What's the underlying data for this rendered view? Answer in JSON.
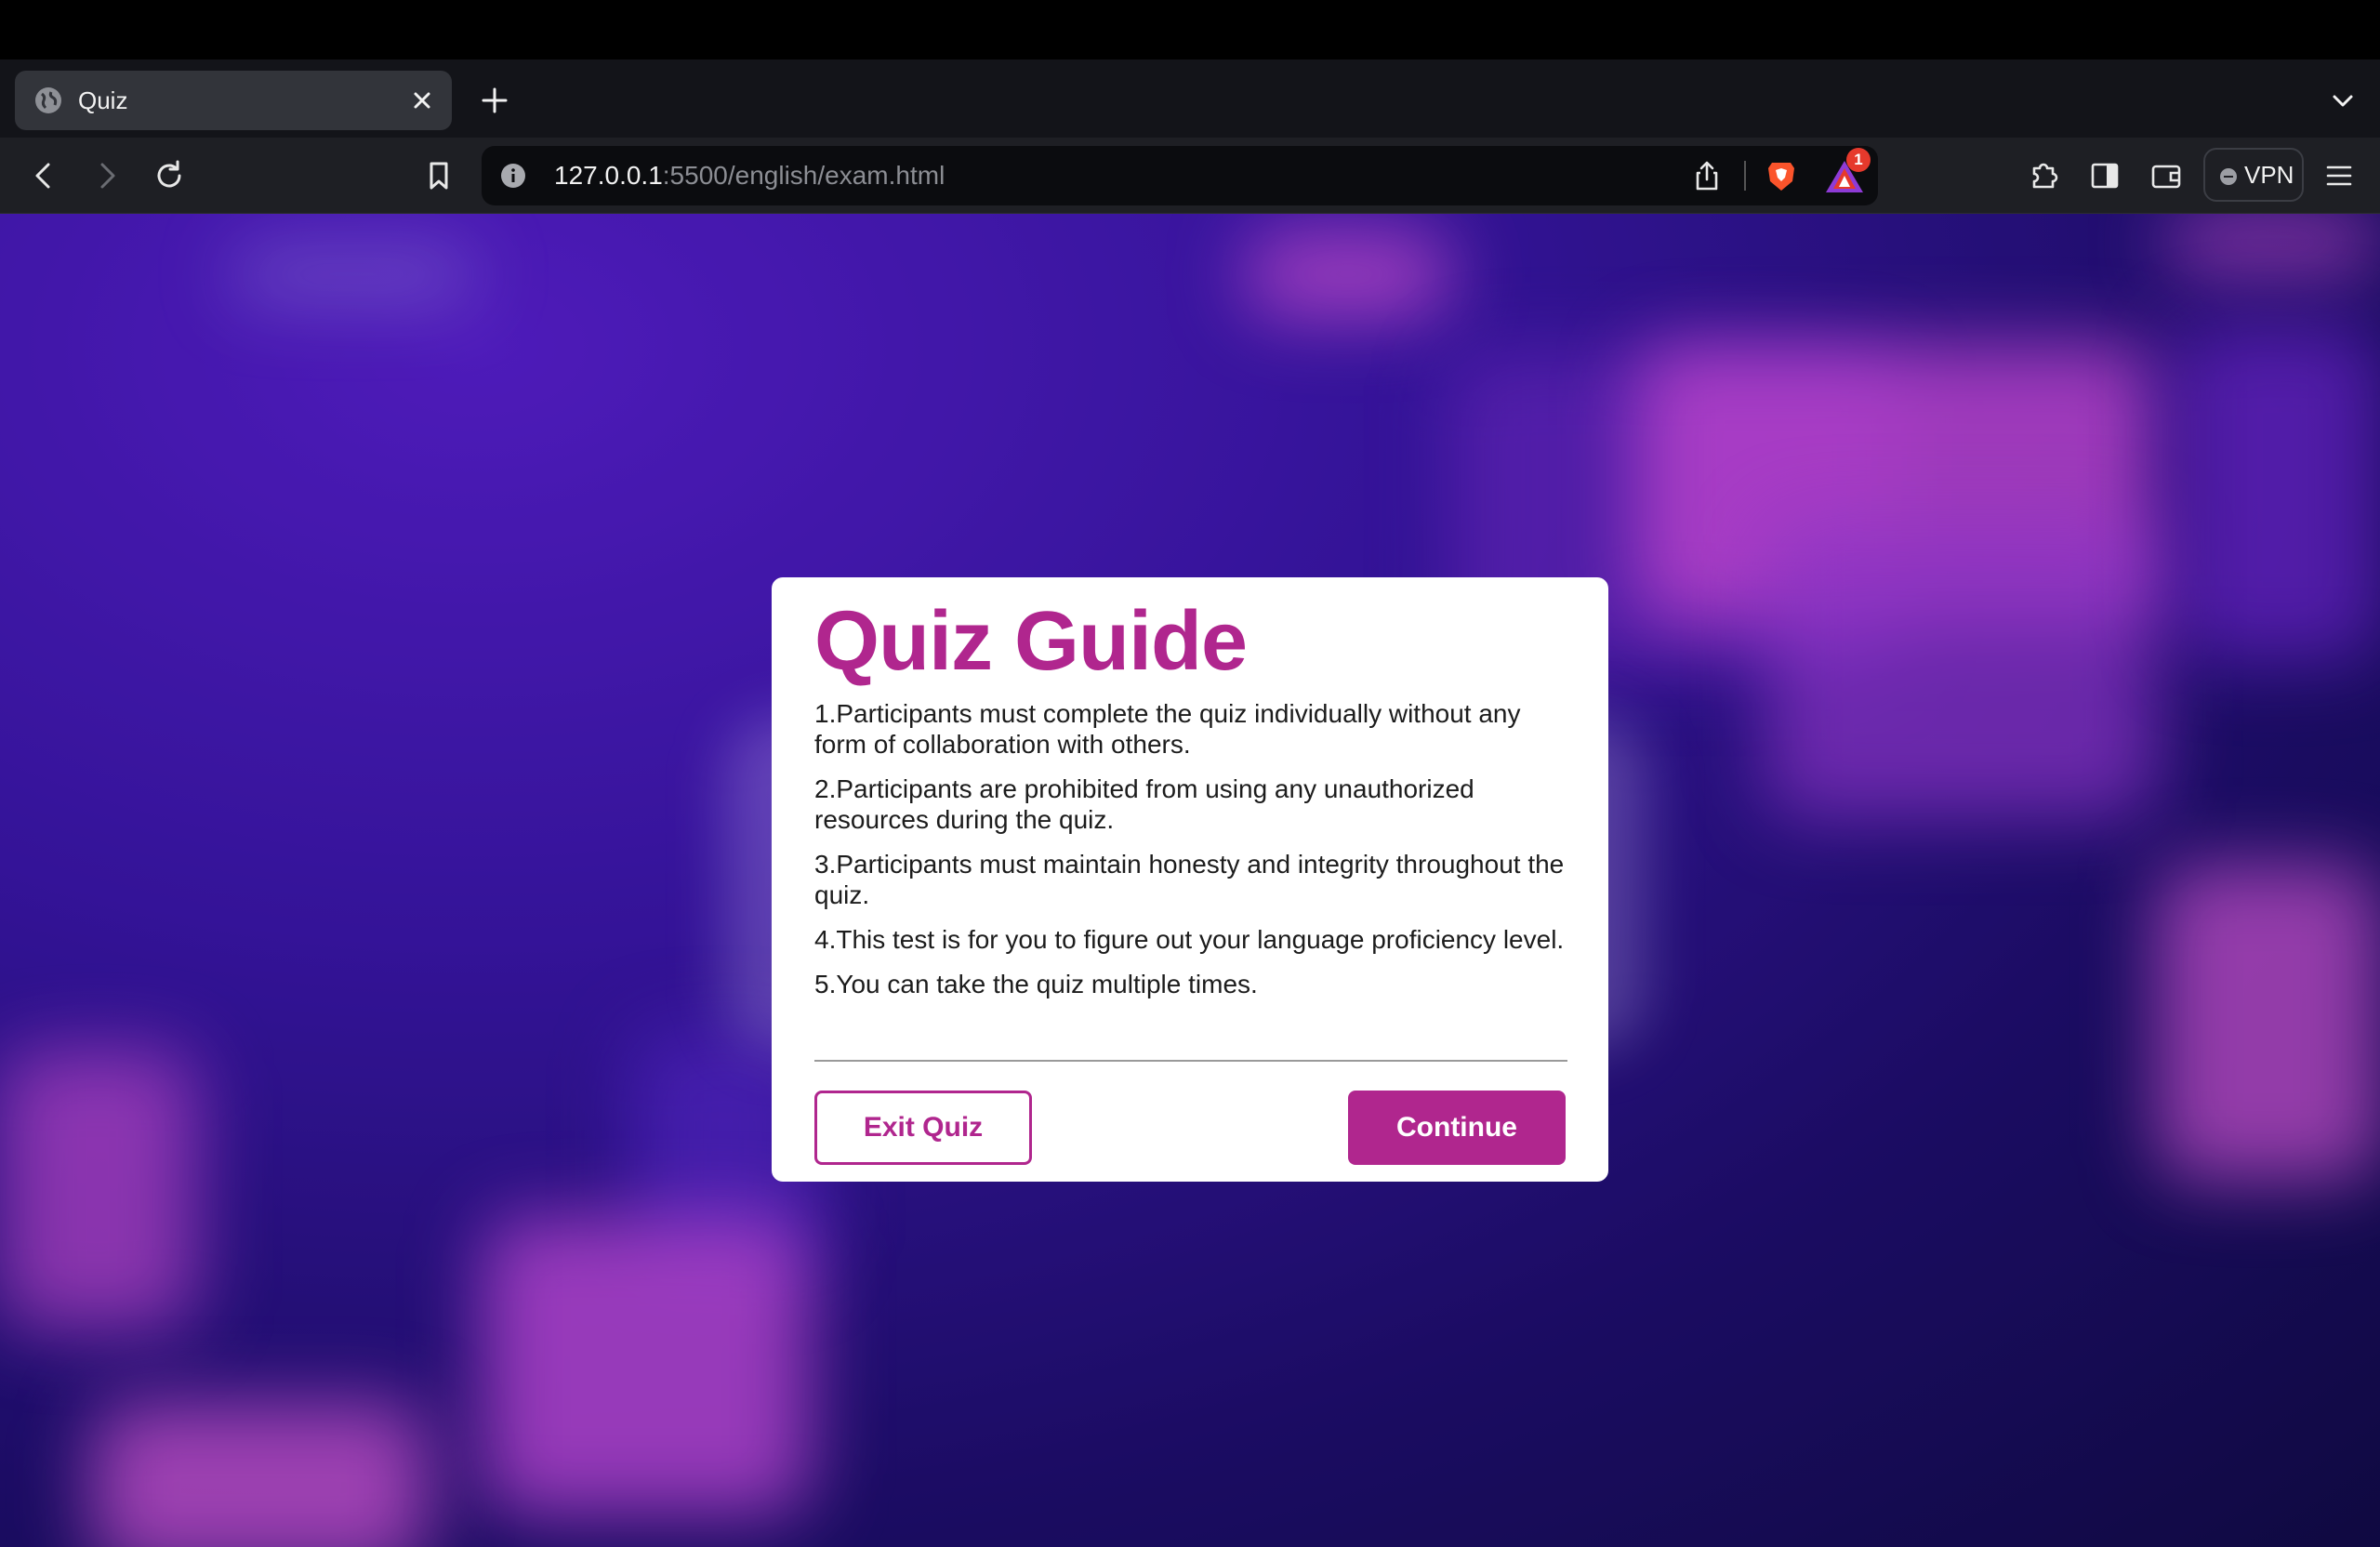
{
  "browser": {
    "tab": {
      "title": "Quiz"
    },
    "address": {
      "host": "127.0.0.1",
      "path": ":5500/english/exam.html"
    },
    "rewards_badge": "1",
    "vpn_label": "VPN"
  },
  "modal": {
    "title": "Quiz Guide",
    "rules": [
      "1.Participants must complete the quiz individually without any form of collaboration with others.",
      "2.Participants are prohibited from using any unauthorized resources during the quiz.",
      "3.Participants must maintain honesty and integrity throughout the quiz.",
      "4.This test is for you to figure out your language proficiency level.",
      "5.You can take the quiz multiple times."
    ],
    "exit_label": "Exit Quiz",
    "continue_label": "Continue"
  },
  "colors": {
    "accent": "#b0268e",
    "background_dark": "#100a42",
    "background_purple": "#5a1fd0"
  },
  "icons": [
    "globe-icon",
    "close-icon",
    "plus-icon",
    "chevron-down-icon",
    "back-arrow-icon",
    "forward-arrow-icon",
    "reload-icon",
    "bookmark-icon",
    "info-icon",
    "share-icon",
    "brave-shield-icon",
    "brave-rewards-icon",
    "extensions-icon",
    "sidebar-icon",
    "wallet-icon",
    "menu-icon"
  ]
}
